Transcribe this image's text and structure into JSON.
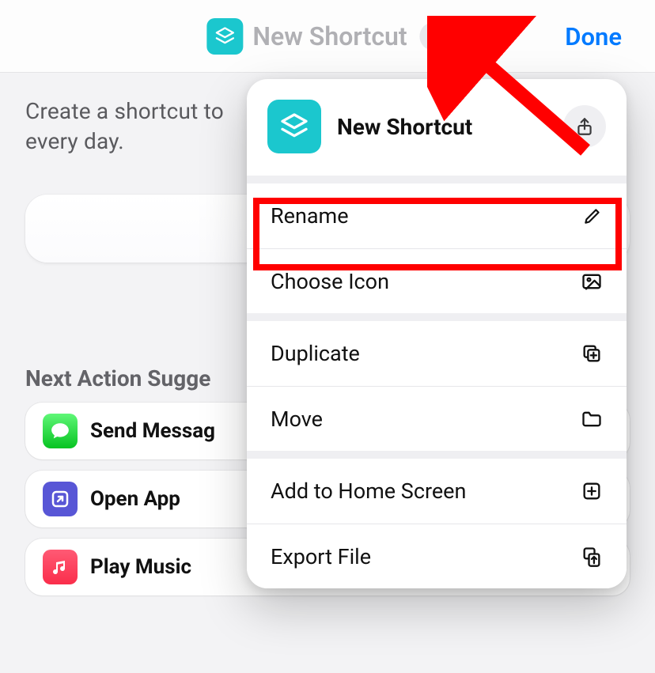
{
  "header": {
    "title": "New Shortcut",
    "done_label": "Done"
  },
  "body": {
    "helper_text_line1": "Create a shortcut to",
    "helper_text_line2": "every day.",
    "section_title": "Next Action Sugge",
    "suggestions": [
      {
        "label": "Send Messag",
        "icon": "messages"
      },
      {
        "label": "Open App",
        "icon": "shortcuts"
      },
      {
        "label": "Play Music",
        "icon": "music"
      }
    ]
  },
  "popover": {
    "title": "New Shortcut",
    "items": [
      {
        "label": "Rename",
        "icon": "pencil"
      },
      {
        "label": "Choose Icon",
        "icon": "image"
      },
      {
        "label": "Duplicate",
        "icon": "duplicate"
      },
      {
        "label": "Move",
        "icon": "folder"
      },
      {
        "label": "Add to Home Screen",
        "icon": "add-square"
      },
      {
        "label": "Export File",
        "icon": "export"
      }
    ]
  },
  "annotation": {
    "highlighted_item_index": 0
  }
}
